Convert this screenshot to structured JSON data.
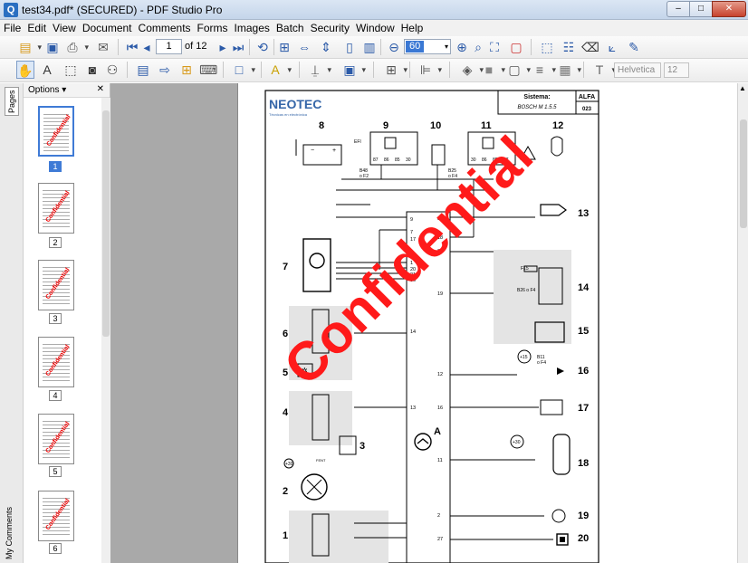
{
  "window": {
    "title": "test34.pdf* (SECURED) - PDF Studio Pro",
    "minimize": "–",
    "maximize": "□",
    "close": "✕"
  },
  "menu": [
    "File",
    "Edit",
    "View",
    "Document",
    "Comments",
    "Forms",
    "Images",
    "Batch",
    "Security",
    "Window",
    "Help"
  ],
  "toolbar": {
    "page_current": "1",
    "page_total": "of 12",
    "zoom": "60",
    "font_name": "Helvetica",
    "font_size": "12"
  },
  "side_tabs": {
    "pages": "Pages",
    "comments": "My Comments"
  },
  "panel": {
    "options": "Options ▾",
    "close": "✕",
    "thumbnail_watermark": "Confidential",
    "thumbnails": [
      "1",
      "2",
      "3",
      "4",
      "5",
      "6"
    ],
    "selected": 0
  },
  "document": {
    "logo": "NEOTEC",
    "logo_tagline": "Técnicas en electrónica",
    "system_label": "Sistema:",
    "system_value": "BOSCH M 1.5.5",
    "brand": "ALFA",
    "code": "023",
    "watermark": "Confidential",
    "component_numbers": {
      "n8": "8",
      "n9": "9",
      "n10": "10",
      "n11": "11",
      "n12": "12",
      "n13": "13",
      "n14": "14",
      "n15": "15",
      "n16": "16",
      "n17": "17",
      "n18": "18",
      "n19": "19",
      "n20": "20",
      "n7": "7",
      "n6": "6",
      "n5": "5",
      "n4": "4",
      "n3": "3",
      "n2": "2",
      "n1": "1",
      "ecu": "A"
    },
    "labels": {
      "efi": "EFI",
      "f_b48": "B48",
      "f_b48b": "o F2",
      "f_b25": "B25",
      "f_b25b": "o F4",
      "b41": "B41",
      "b41b": "o F3",
      "f15": "F15",
      "b26": "B26 o F4",
      "b11": "B11",
      "b11b": "o F4",
      "plus15": "+15",
      "plus30": "+30",
      "plus30b": "+30",
      "fuse_b": "FENT",
      "a7_5": "7.5 A",
      "a10": "10 A",
      "a15": "15 A",
      "p87": "87",
      "p86": "86",
      "p85": "85",
      "p30": "30",
      "pins_left": [
        "9",
        "7",
        "17",
        "1",
        "20",
        "21",
        "30",
        "19",
        "14",
        "13"
      ],
      "pins_right": [
        "8",
        "18",
        "3",
        "12",
        "16",
        "11",
        "2",
        "27"
      ]
    }
  }
}
